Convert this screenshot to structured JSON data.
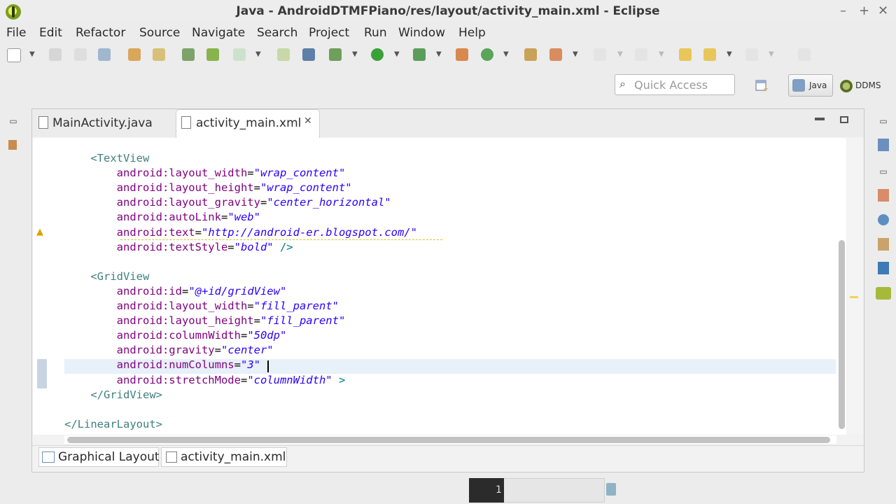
{
  "window": {
    "title": "Java - AndroidDTMFPiano/res/layout/activity_main.xml - Eclipse",
    "minimize_glyph": "–",
    "maximize_glyph": "+",
    "close_glyph": "✕"
  },
  "menu": [
    "File",
    "Edit",
    "Refactor",
    "Source",
    "Navigate",
    "Search",
    "Project",
    "Run",
    "Window",
    "Help"
  ],
  "toolbar": {
    "quick_access_placeholder": "Quick Access",
    "perspectives": [
      {
        "label": "Java",
        "icon": "java-perspective-icon",
        "active": true
      },
      {
        "label": "DDMS",
        "icon": "ddms-perspective-icon",
        "active": false
      }
    ]
  },
  "editor": {
    "tabs": [
      {
        "label": "MainActivity.java",
        "icon": "java-file-icon",
        "active": false
      },
      {
        "label": "activity_main.xml",
        "icon": "xml-file-icon",
        "active": true,
        "close_glyph": "✕"
      }
    ],
    "lines": [
      [
        {
          "t": "    ",
          "c": ""
        },
        {
          "t": "<TextView",
          "c": "tag"
        }
      ],
      [
        {
          "t": "        ",
          "c": ""
        },
        {
          "t": "android:layout_width",
          "c": "attr"
        },
        {
          "t": "=",
          "c": "eq"
        },
        {
          "t": "\"wrap_content\"",
          "c": "val"
        }
      ],
      [
        {
          "t": "        ",
          "c": ""
        },
        {
          "t": "android:layout_height",
          "c": "attr"
        },
        {
          "t": "=",
          "c": "eq"
        },
        {
          "t": "\"wrap_content\"",
          "c": "val"
        }
      ],
      [
        {
          "t": "        ",
          "c": ""
        },
        {
          "t": "android:layout_gravity",
          "c": "attr"
        },
        {
          "t": "=",
          "c": "eq"
        },
        {
          "t": "\"center_horizontal\"",
          "c": "val"
        }
      ],
      [
        {
          "t": "        ",
          "c": ""
        },
        {
          "t": "android:autoLink",
          "c": "attr"
        },
        {
          "t": "=",
          "c": "eq"
        },
        {
          "t": "\"web\"",
          "c": "val"
        }
      ],
      [
        {
          "t": "        ",
          "c": ""
        },
        {
          "t": "android:text",
          "c": "attr"
        },
        {
          "t": "=",
          "c": "eq"
        },
        {
          "t": "\"http://android-er.blogspot.com/\"",
          "c": "val"
        }
      ],
      [
        {
          "t": "        ",
          "c": ""
        },
        {
          "t": "android:textStyle",
          "c": "attr"
        },
        {
          "t": "=",
          "c": "eq"
        },
        {
          "t": "\"bold\"",
          "c": "val"
        },
        {
          "t": " />",
          "c": "punct"
        }
      ],
      [
        {
          "t": "",
          "c": ""
        }
      ],
      [
        {
          "t": "    ",
          "c": ""
        },
        {
          "t": "<GridView",
          "c": "tag"
        }
      ],
      [
        {
          "t": "        ",
          "c": ""
        },
        {
          "t": "android:id",
          "c": "attr"
        },
        {
          "t": "=",
          "c": "eq"
        },
        {
          "t": "\"@+id/gridView\"",
          "c": "val"
        }
      ],
      [
        {
          "t": "        ",
          "c": ""
        },
        {
          "t": "android:layout_width",
          "c": "attr"
        },
        {
          "t": "=",
          "c": "eq"
        },
        {
          "t": "\"fill_parent\"",
          "c": "val"
        }
      ],
      [
        {
          "t": "        ",
          "c": ""
        },
        {
          "t": "android:layout_height",
          "c": "attr"
        },
        {
          "t": "=",
          "c": "eq"
        },
        {
          "t": "\"fill_parent\"",
          "c": "val"
        }
      ],
      [
        {
          "t": "        ",
          "c": ""
        },
        {
          "t": "android:columnWidth",
          "c": "attr"
        },
        {
          "t": "=",
          "c": "eq"
        },
        {
          "t": "\"50dp\"",
          "c": "val"
        }
      ],
      [
        {
          "t": "        ",
          "c": ""
        },
        {
          "t": "android:gravity",
          "c": "attr"
        },
        {
          "t": "=",
          "c": "eq"
        },
        {
          "t": "\"center\"",
          "c": "val"
        }
      ],
      [
        {
          "t": "        ",
          "c": ""
        },
        {
          "t": "android:numColumns",
          "c": "attr"
        },
        {
          "t": "=",
          "c": "eq"
        },
        {
          "t": "\"3\"",
          "c": "val"
        }
      ],
      [
        {
          "t": "        ",
          "c": ""
        },
        {
          "t": "android:stretchMode",
          "c": "attr"
        },
        {
          "t": "=",
          "c": "eq"
        },
        {
          "t": "\"columnWidth\"",
          "c": "val"
        },
        {
          "t": " >",
          "c": "punct"
        }
      ],
      [
        {
          "t": "    ",
          "c": ""
        },
        {
          "t": "</GridView>",
          "c": "tag"
        }
      ],
      [
        {
          "t": "",
          "c": ""
        }
      ],
      [
        {
          "t": "</LinearLayout>",
          "c": "tag"
        }
      ]
    ],
    "bottom_tabs": [
      {
        "label": "Graphical Layout",
        "icon": "graphical-layout-icon"
      },
      {
        "label": "activity_main.xml",
        "icon": "xml-source-icon"
      }
    ]
  },
  "statusbar": {
    "count": "1"
  }
}
